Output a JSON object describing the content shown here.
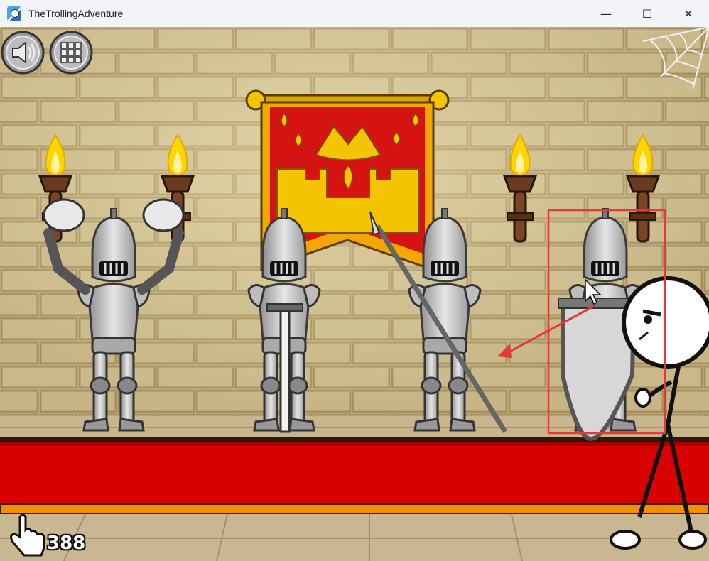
{
  "window": {
    "title": "TheTrollingAdventure",
    "controls": {
      "minimize": "—",
      "maximize": "☐",
      "close": "✕"
    }
  },
  "hud": {
    "sound_icon": "speaker-icon",
    "menu_icon": "grid-menu-icon",
    "click_counter": "388",
    "counter_icon": "pointing-hand-icon"
  },
  "scene": {
    "colors": {
      "wall": "#c9b98d",
      "brick_line": "#a89566",
      "carpet": "#d90000",
      "banner": "#d61313",
      "banner_gold": "#f2c200",
      "flame": "#ffd400",
      "highlight_box": "#e53935"
    }
  }
}
